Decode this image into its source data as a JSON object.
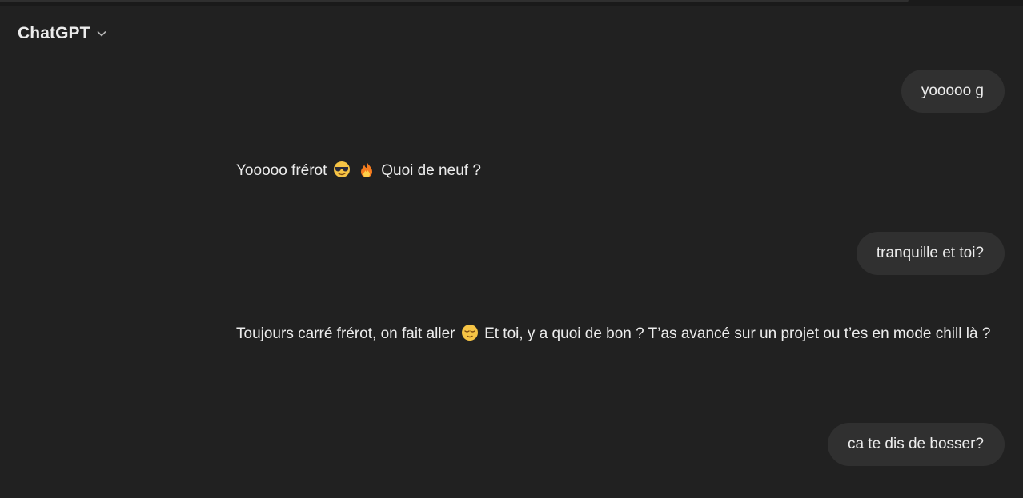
{
  "header": {
    "title": "ChatGPT",
    "chevron_icon": "chevron-down-icon"
  },
  "messages": [
    {
      "role": "user",
      "text": "yooooo g"
    },
    {
      "role": "assistant",
      "parts": [
        "Yooooo frérot",
        "Quoi de neuf ?"
      ],
      "emojis": [
        "sunglasses-emoji",
        "fire-emoji"
      ]
    },
    {
      "role": "user",
      "text": "tranquille et toi?"
    },
    {
      "role": "assistant",
      "parts": [
        "Toujours carré frérot, on fait aller",
        "Et toi, y a quoi de bon ? T’as avancé sur un projet ou t’es en mode chill là ?"
      ],
      "emojis": [
        "relieved-emoji"
      ]
    },
    {
      "role": "user",
      "text": "ca te dis de bosser?"
    }
  ],
  "colors": {
    "background": "#212121",
    "bubble": "#303030",
    "text": "#ececec"
  }
}
